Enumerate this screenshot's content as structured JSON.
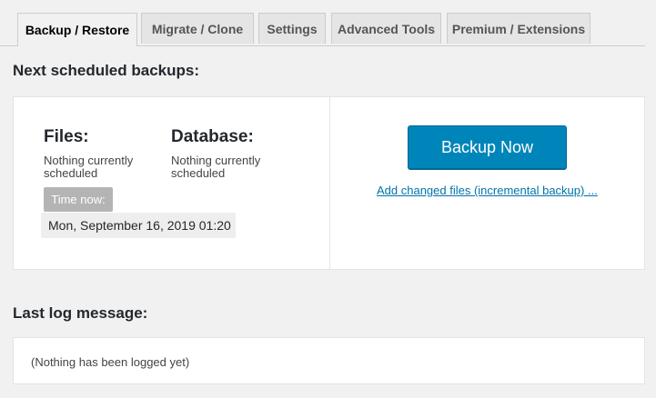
{
  "tabs": [
    {
      "label": "Backup / Restore"
    },
    {
      "label": "Migrate / Clone"
    },
    {
      "label": "Settings"
    },
    {
      "label": "Advanced Tools"
    },
    {
      "label": "Premium / Extensions"
    }
  ],
  "active_tab": "Backup / Restore",
  "scheduled": {
    "heading": "Next scheduled backups:",
    "files_title": "Files:",
    "files_status": "Nothing currently scheduled",
    "database_title": "Database:",
    "database_status": "Nothing currently scheduled",
    "time_now_label": "Time now:",
    "time_now_value": "Mon, September 16, 2019 01:20",
    "backup_now_label": "Backup Now",
    "incremental_link": "Add changed files (incremental backup) ..."
  },
  "log": {
    "heading": "Last log message:",
    "message": "(Nothing has been logged yet)"
  },
  "colors": {
    "primary_button": "#0085ba",
    "link": "#0073aa",
    "page_background": "#f1f1f1"
  }
}
